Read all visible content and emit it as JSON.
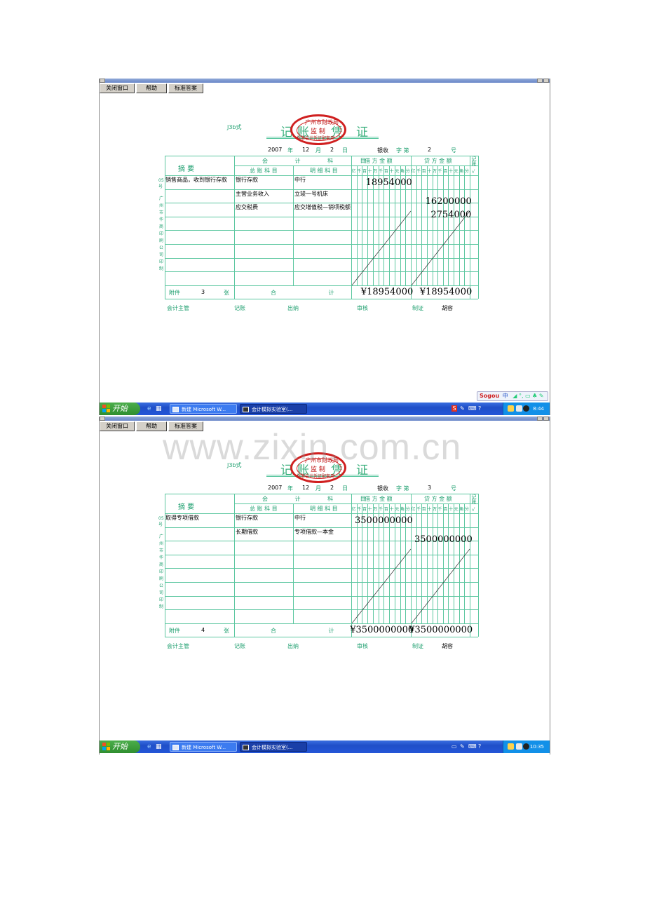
{
  "menu": {
    "close": "关闭窗口",
    "help": "帮助",
    "answer": "标准答案"
  },
  "form_code": "J3b式",
  "voucher_title": [
    "记",
    "账",
    "凭",
    "证"
  ],
  "seal": {
    "line1": "广州市财政局",
    "line2": "监 制",
    "line3": "标准会计凭证配套用"
  },
  "date_units": {
    "year": "年",
    "month": "月",
    "day": "日"
  },
  "zi_label": "字 第",
  "hao_label": "号",
  "headers": {
    "zhaiyao": "摘 要",
    "kuaiji_kemu": "会 计 科 目",
    "zongzhang": "总 账 科 目",
    "mingxi": "明 细 科 目",
    "jiefang": "借 方 金 额",
    "daifang": "贷 方 金 额",
    "jizhang": "记账",
    "check": "√",
    "digits": [
      "亿",
      "千",
      "百",
      "十",
      "万",
      "千",
      "百",
      "十",
      "元",
      "角",
      "分"
    ]
  },
  "side_printer": [
    "广",
    "州",
    "市",
    "华",
    "商",
    "印",
    "刷",
    "公",
    "司",
    "印",
    "制"
  ],
  "footer": {
    "fujian": "附件",
    "zhang": "张",
    "heji": "合 计",
    "zhuguan": "会计主管",
    "jizhang": "记账",
    "chuna": "出纳",
    "shenhe": "审核",
    "zhizheng": "制证",
    "maker": "胡容"
  },
  "vouchers": [
    {
      "year": "2007",
      "month": "12",
      "day": "2",
      "zi": "银收",
      "no": "2",
      "attachments": "3",
      "side_mark": "05号",
      "rows": [
        {
          "desc": "销售商品，收到银行存款",
          "gen": "银行存款",
          "sub": "中行",
          "debit": "18954000",
          "credit": ""
        },
        {
          "desc": "",
          "gen": "主营业务收入",
          "sub": "立竣一号机床",
          "debit": "",
          "credit": "16200000"
        },
        {
          "desc": "",
          "gen": "应交税费",
          "sub": "应交增值税—销项税额",
          "debit": "",
          "credit": "2754000"
        }
      ],
      "total_debit": "¥18954000",
      "total_credit": "¥18954000"
    },
    {
      "year": "2007",
      "month": "12",
      "day": "2",
      "zi": "银收",
      "no": "3",
      "attachments": "4",
      "side_mark": "05号",
      "rows": [
        {
          "desc": "取得专项借款",
          "gen": "银行存款",
          "sub": "中行",
          "debit": "3500000000",
          "credit": ""
        },
        {
          "desc": "",
          "gen": "长期借款",
          "sub": "专项借款—本金",
          "debit": "",
          "credit": "3500000000"
        }
      ],
      "total_debit": "¥3500000000",
      "total_credit": "¥3500000000"
    }
  ],
  "taskbar": {
    "start": "开始",
    "item1": "新建 Microsoft W...",
    "item2": "会计模拟实验室(...",
    "clock1": "8:44",
    "clock2": "10:35"
  },
  "ime": {
    "logo": "Sogou",
    "mode": "中"
  },
  "watermark": "www.zixin.com.cn",
  "colors": {
    "form_green": "#5cc7a0",
    "seal_red": "#d02020",
    "taskbar_blue": "#2456d8",
    "start_green": "#3a9e3a"
  }
}
